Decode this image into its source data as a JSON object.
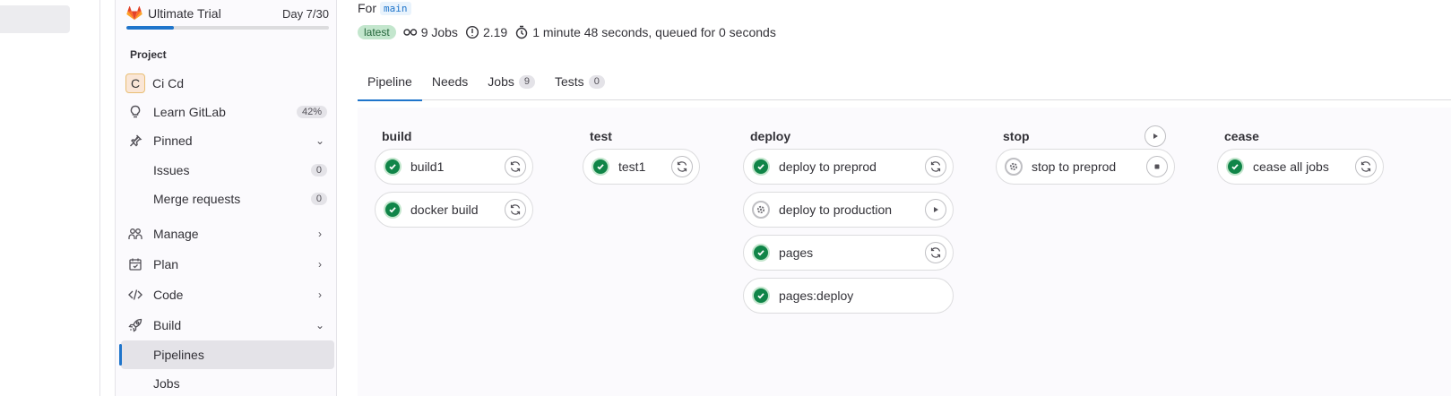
{
  "sidebar": {
    "trial": {
      "name": "Ultimate Trial",
      "day": "Day 7/30",
      "progress": 0.233
    },
    "section_label": "Project",
    "project": {
      "avatar_letter": "C",
      "name": "Ci Cd"
    },
    "learn": {
      "label": "Learn GitLab",
      "badge": "42%"
    },
    "pinned": {
      "label": "Pinned"
    },
    "issues": {
      "label": "Issues",
      "count": "0"
    },
    "merge_requests": {
      "label": "Merge requests",
      "count": "0"
    },
    "manage": {
      "label": "Manage"
    },
    "plan": {
      "label": "Plan"
    },
    "code": {
      "label": "Code"
    },
    "build": {
      "label": "Build"
    },
    "pipelines": {
      "label": "Pipelines"
    },
    "jobs": {
      "label": "Jobs"
    }
  },
  "header": {
    "for_label": "For",
    "branch": "main",
    "latest_badge": "latest",
    "jobs_count": "9 Jobs",
    "duration_value": "2.19",
    "timing": "1 minute 48 seconds, queued for 0 seconds"
  },
  "tabs": [
    {
      "label": "Pipeline",
      "count": null
    },
    {
      "label": "Needs",
      "count": null
    },
    {
      "label": "Jobs",
      "count": "9"
    },
    {
      "label": "Tests",
      "count": "0"
    }
  ],
  "stages": {
    "build": {
      "title": "build",
      "jobs": [
        "build1",
        "docker build"
      ]
    },
    "test": {
      "title": "test",
      "jobs": [
        "test1"
      ]
    },
    "deploy": {
      "title": "deploy",
      "jobs": [
        "deploy to preprod",
        "deploy to production",
        "pages",
        "pages:deploy"
      ]
    },
    "stop": {
      "title": "stop",
      "jobs": [
        "stop to preprod"
      ]
    },
    "cease": {
      "title": "cease",
      "jobs": [
        "cease all jobs"
      ]
    }
  },
  "colors": {
    "accent": "#1f75cb",
    "success": "#108548",
    "latest_bg": "#c3e6cd"
  }
}
